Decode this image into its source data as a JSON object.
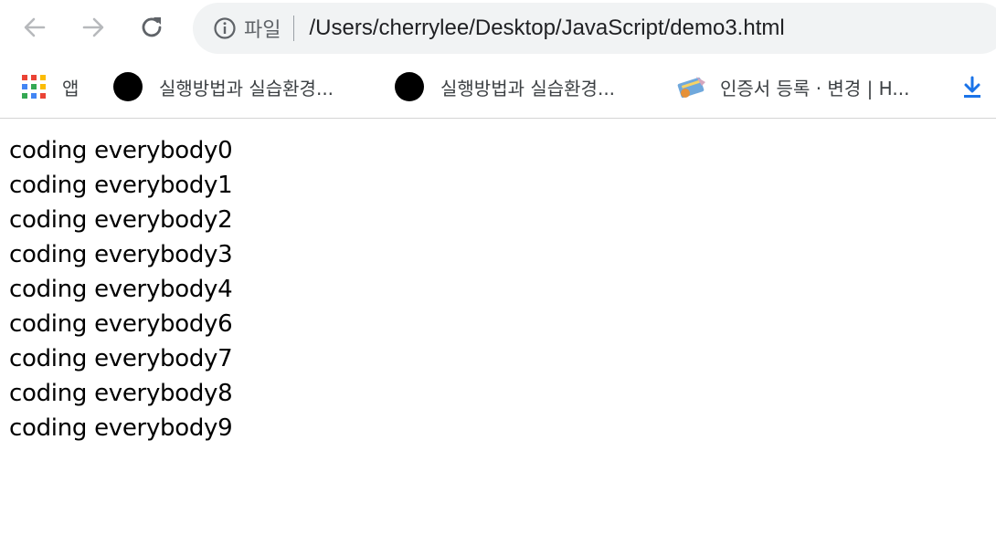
{
  "browser": {
    "scheme_label": "파일",
    "url": "/Users/cherrylee/Desktop/JavaScript/demo3.html"
  },
  "bookmarks": {
    "apps_label": "앱",
    "items": [
      {
        "label": "실행방법과 실습환경..."
      },
      {
        "label": "실행방법과 실습환경..."
      },
      {
        "label": "인증서 등록 · 변경 | H..."
      }
    ]
  },
  "page": {
    "lines": [
      "coding everybody0",
      "coding everybody1",
      "coding everybody2",
      "coding everybody3",
      "coding everybody4",
      "coding everybody6",
      "coding everybody7",
      "coding everybody8",
      "coding everybody9"
    ]
  },
  "colors": {
    "omnibox_bg": "#f1f3f4",
    "download_blue": "#1a73e8"
  }
}
